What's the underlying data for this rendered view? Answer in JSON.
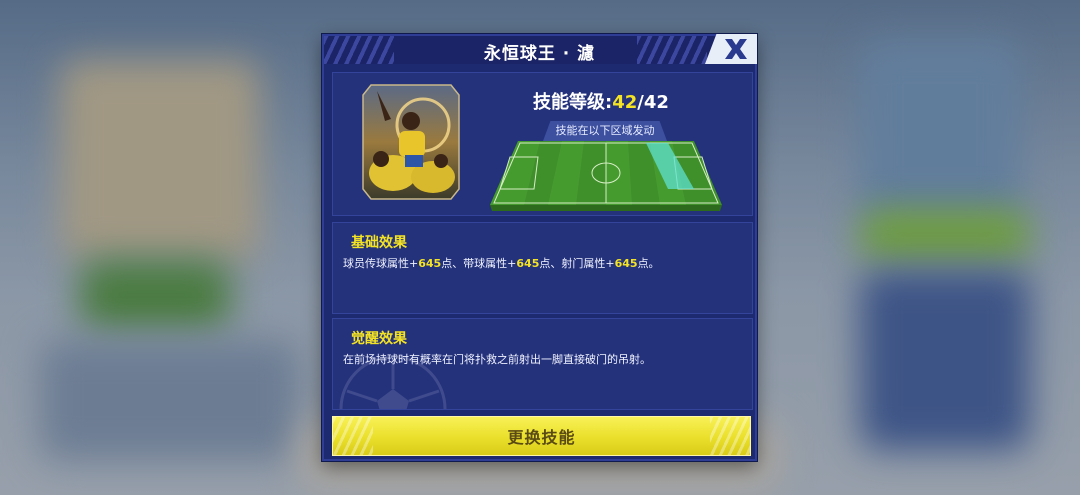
{
  "dialog": {
    "title": "永恒球王 · 濾",
    "close_icon": "close-x-icon"
  },
  "skill": {
    "level_label": "技能等级:",
    "level_current": "42",
    "level_sep": "/",
    "level_max": "42",
    "zone_label": "技能在以下区域发动"
  },
  "basic_effect": {
    "title": "基础效果",
    "parts": [
      "球员传球属性+",
      "645",
      "点、带球属性+",
      "645",
      "点、射门属性+",
      "645",
      "点。"
    ]
  },
  "awaken_effect": {
    "title": "觉醒效果",
    "text": "在前场持球时有概率在门将扑救之前射出一脚直接破门的吊射。"
  },
  "change_button": {
    "label": "更换技能"
  }
}
